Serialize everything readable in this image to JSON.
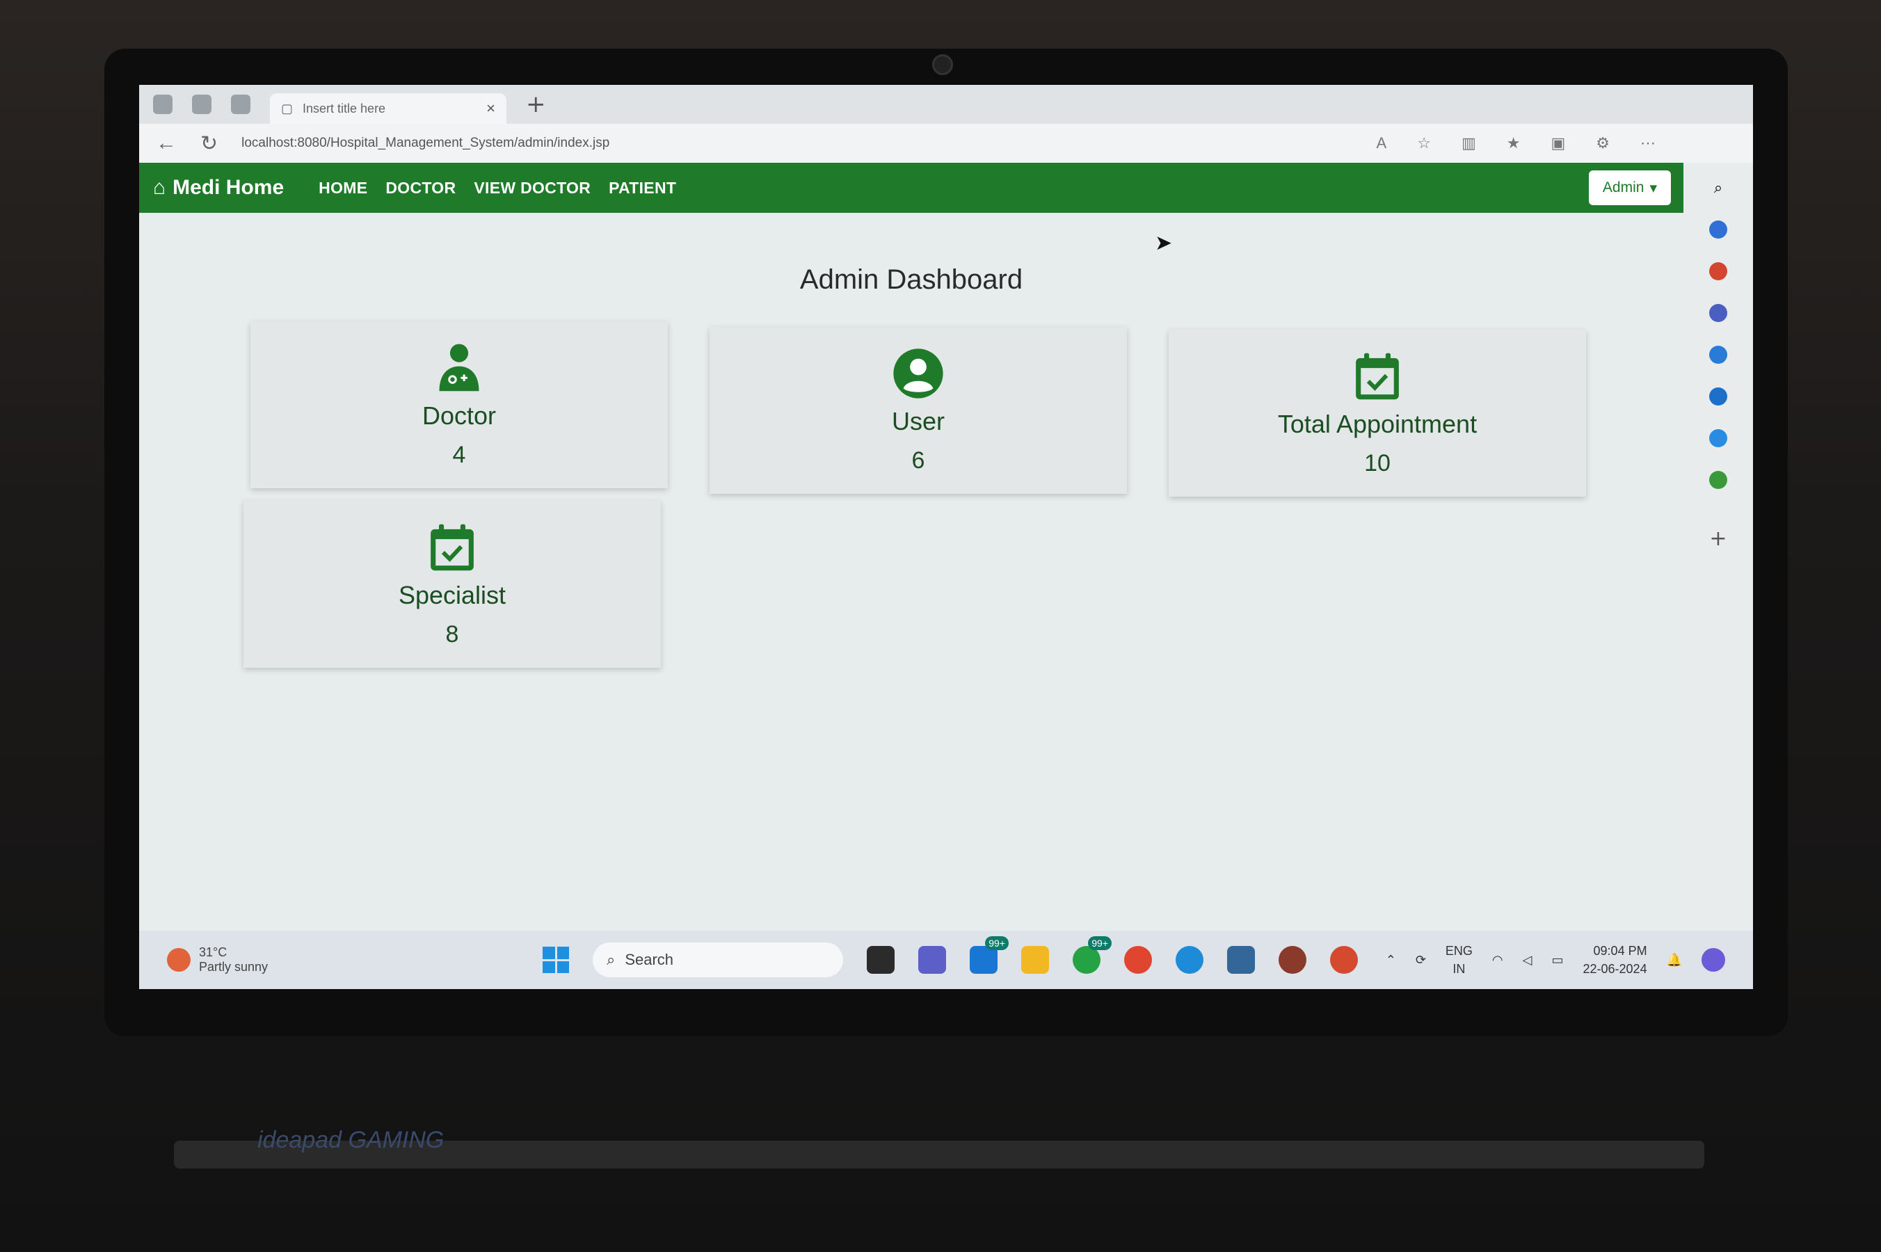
{
  "browser": {
    "tab_title": "Insert title here",
    "tab_close": "×",
    "new_tab": "+",
    "back": "←",
    "refresh": "↻",
    "url": "localhost:8080/Hospital_Management_System/admin/index.jsp",
    "tab_actions": "⋯"
  },
  "navbar": {
    "brand": "Medi Home",
    "brand_icon": "home-icon",
    "links": [
      "HOME",
      "DOCTOR",
      "VIEW DOCTOR",
      "PATIENT"
    ],
    "admin_label": "Admin",
    "admin_caret": "▾",
    "color": "#1f7a2a"
  },
  "dashboard": {
    "title": "Admin Dashboard",
    "cards": [
      {
        "label": "Doctor",
        "value": "4",
        "icon": "doctor-icon"
      },
      {
        "label": "User",
        "value": "6",
        "icon": "user-circle-icon"
      },
      {
        "label": "Total Appointment",
        "value": "10",
        "icon": "calendar-check-icon"
      },
      {
        "label": "Specialist",
        "value": "8",
        "icon": "calendar-check-icon"
      }
    ]
  },
  "taskbar": {
    "weather_temp": "31°C",
    "weather_desc": "Partly sunny",
    "search_placeholder": "Search",
    "mail_badge": "99+",
    "whatsapp_badge": "99+",
    "lang_line1": "ENG",
    "lang_line2": "IN",
    "time": "09:04 PM",
    "date": "22-06-2024"
  },
  "sidebar_add": "+",
  "laptop_brand": "ideapad GAMING"
}
